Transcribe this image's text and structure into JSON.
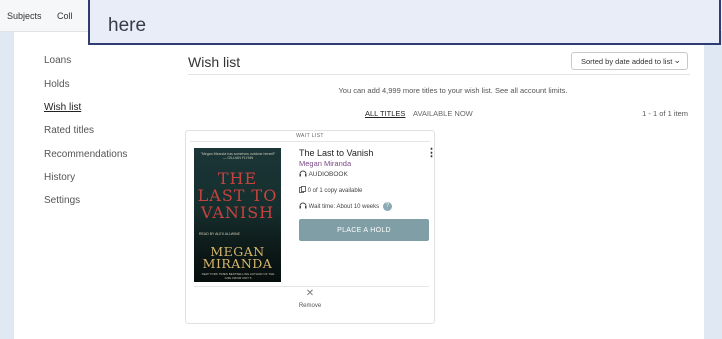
{
  "topnav": {
    "subjects": "Subjects",
    "collections": "Coll"
  },
  "banner": {
    "text": "here"
  },
  "sidebar": {
    "items": [
      {
        "label": "Loans"
      },
      {
        "label": "Holds"
      },
      {
        "label": "Wish list"
      },
      {
        "label": "Rated titles"
      },
      {
        "label": "Recommendations"
      },
      {
        "label": "History"
      },
      {
        "label": "Settings"
      }
    ],
    "active_index": 2
  },
  "main": {
    "title": "Wish list",
    "sort_label": "Sorted by date added to list",
    "limit_text": "You can add 4,999 more titles to your wish list. See all account limits.",
    "tabs": [
      {
        "label": "ALL TITLES",
        "active": true
      },
      {
        "label": "AVAILABLE NOW",
        "active": false
      }
    ],
    "count": "1 - 1 of 1 item"
  },
  "card": {
    "banner": "WAIT LIST",
    "cover": {
      "top_text": "\"Megan Miranda has somehow outdone herself\" — GILLIAN FLYNN",
      "title": "THE LAST TO VANISH",
      "narrator": "READ BY ALEX ALLWINE",
      "author": "MEGAN MIRANDA",
      "bottom_text": "NEW YORK TIMES BESTSELLING AUTHOR OF THE GIRL FROM UNIT 5"
    },
    "title": "The Last to Vanish",
    "author": "Megan Miranda",
    "format": "AUDIOBOOK",
    "availability": "0 of 1 copy available",
    "wait_time": "Wait time: About 10 weeks",
    "hold_button": "PLACE A HOLD",
    "remove_label": "Remove",
    "more_icon": "⋮",
    "remove_icon": "✕",
    "help_icon": "?"
  },
  "colors": {
    "accent": "#7f9ea5",
    "author": "#7a4a87",
    "banner_border": "#2f3d73",
    "side_bar": "#dfe8f3"
  }
}
